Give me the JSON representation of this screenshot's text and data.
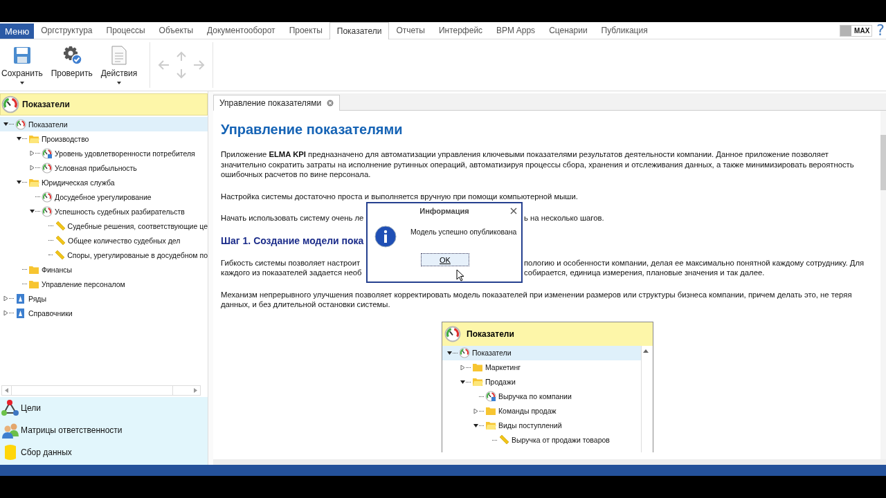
{
  "menu_button": "Меню",
  "nav_tabs": [
    {
      "label": "Оргструктура",
      "selected": false
    },
    {
      "label": "Процессы",
      "selected": false
    },
    {
      "label": "Объекты",
      "selected": false
    },
    {
      "label": "Документооборот",
      "selected": false
    },
    {
      "label": "Проекты",
      "selected": false
    },
    {
      "label": "Показатели",
      "selected": true
    },
    {
      "label": "Отчеты",
      "selected": false
    },
    {
      "label": "Интерфейс",
      "selected": false
    },
    {
      "label": "BPM Apps",
      "selected": false
    },
    {
      "label": "Сценарии",
      "selected": false
    },
    {
      "label": "Публикация",
      "selected": false
    }
  ],
  "mode_switch": {
    "label": "MAX",
    "on": true
  },
  "help": "?",
  "toolbar": [
    {
      "label": "Сохранить",
      "dropdown": true
    },
    {
      "label": "Проверить",
      "dropdown": false
    },
    {
      "label": "Действия",
      "dropdown": true
    }
  ],
  "sidebar": {
    "title": "Показатели",
    "tree": [
      {
        "label": "Показатели",
        "kind": "kpi",
        "expanded": true,
        "selected": true,
        "children": [
          {
            "label": "Производство",
            "kind": "folder-open",
            "expanded": true,
            "selected": false,
            "children": [
              {
                "label": "Уровень удовлетворенности потребителя",
                "kind": "kpi-user",
                "expanded": false,
                "selected": false
              },
              {
                "label": "Условная прибыльность",
                "kind": "kpi",
                "expanded": false,
                "selected": false
              }
            ]
          },
          {
            "label": "Юридическая служба",
            "kind": "folder-open",
            "expanded": true,
            "selected": false,
            "children": [
              {
                "label": "Досудебное урегулирование",
                "kind": "kpi",
                "selected": false
              },
              {
                "label": "Успешность судебных разбирательств",
                "kind": "kpi",
                "expanded": true,
                "selected": false,
                "children": [
                  {
                    "label": "Судебные решения, соответствующие це",
                    "kind": "ruler",
                    "selected": false
                  },
                  {
                    "label": "Общее количество судебных дел",
                    "kind": "ruler",
                    "selected": false
                  },
                  {
                    "label": "Споры, урегулированые в досудебном по",
                    "kind": "ruler",
                    "selected": false
                  }
                ]
              }
            ]
          },
          {
            "label": "Финансы",
            "kind": "folder",
            "selected": false
          },
          {
            "label": "Управление персоналом",
            "kind": "folder",
            "selected": false
          }
        ]
      },
      {
        "label": "Ряды",
        "kind": "series",
        "expanded": false,
        "selected": false
      },
      {
        "label": "Справочники",
        "kind": "series",
        "expanded": false,
        "selected": false
      }
    ],
    "sections": [
      {
        "label": "Цели"
      },
      {
        "label": "Матрицы ответственности"
      },
      {
        "label": "Сбор данных"
      }
    ]
  },
  "document_tab": {
    "label": "Управление показателями"
  },
  "article": {
    "title": "Управление показателями",
    "blocks": [
      {
        "kind": "para",
        "text": "Приложение **ELMA KPI** предназначено для автоматизации управления ключевыми показателями результатов деятельности компании. Данное приложение позволяет значительно сократить затраты на исполнение рутинных операций, автоматизируя процессы сбора, хранения и отслеживания данных, а также минимизировать вероятность ошибочных расчетов по вине персонала."
      },
      {
        "kind": "para",
        "text": "Настройка системы достаточно проста и выполняется вручную при помощи компьютерной мыши."
      },
      {
        "kind": "split",
        "lines": [
          {
            "left": "Начать использовать систему очень ле",
            "right": "ь на несколько шагов."
          }
        ]
      },
      {
        "kind": "heading",
        "text": "Шаг 1. Создание модели пока"
      },
      {
        "kind": "split",
        "lines": [
          {
            "left": "Гибкость системы позволяет настроит",
            "right": "пологию и особенности компании, делая ее максимально понятной каждому сотруднику. Для"
          },
          {
            "left": "каждого из показателей задается необ",
            "right": "собирается, единица измерения, плановые значения и так далее."
          }
        ]
      },
      {
        "kind": "para",
        "text": "Механизм непрерывного улучшения позволяет корректировать модель показателей при изменении размеров или структуры бизнеса компании, причем делать это, не теряя данных, и без длительной остановки системы."
      }
    ],
    "figure": {
      "title": "Показатели",
      "tree": [
        {
          "label": "Показатели",
          "kind": "kpi",
          "expanded": true,
          "selected": true,
          "children": [
            {
              "label": "Маркетинг",
              "kind": "folder",
              "expanded": false,
              "selected": false
            },
            {
              "label": "Продажи",
              "kind": "folder-open",
              "expanded": true,
              "selected": false,
              "children": [
                {
                  "label": "Выручка по компании",
                  "kind": "kpi-user",
                  "selected": false
                },
                {
                  "label": "Команды продаж",
                  "kind": "folder",
                  "expanded": false,
                  "selected": false
                },
                {
                  "label": "Виды поступлений",
                  "kind": "folder-open",
                  "expanded": true,
                  "selected": false,
                  "children": [
                    {
                      "label": "Выручка от продажи товаров",
                      "kind": "ruler",
                      "selected": false
                    }
                  ]
                }
              ]
            }
          ]
        }
      ]
    }
  },
  "dialog": {
    "title": "Информация",
    "message": "Модель успешно опубликована",
    "button": "OK"
  }
}
